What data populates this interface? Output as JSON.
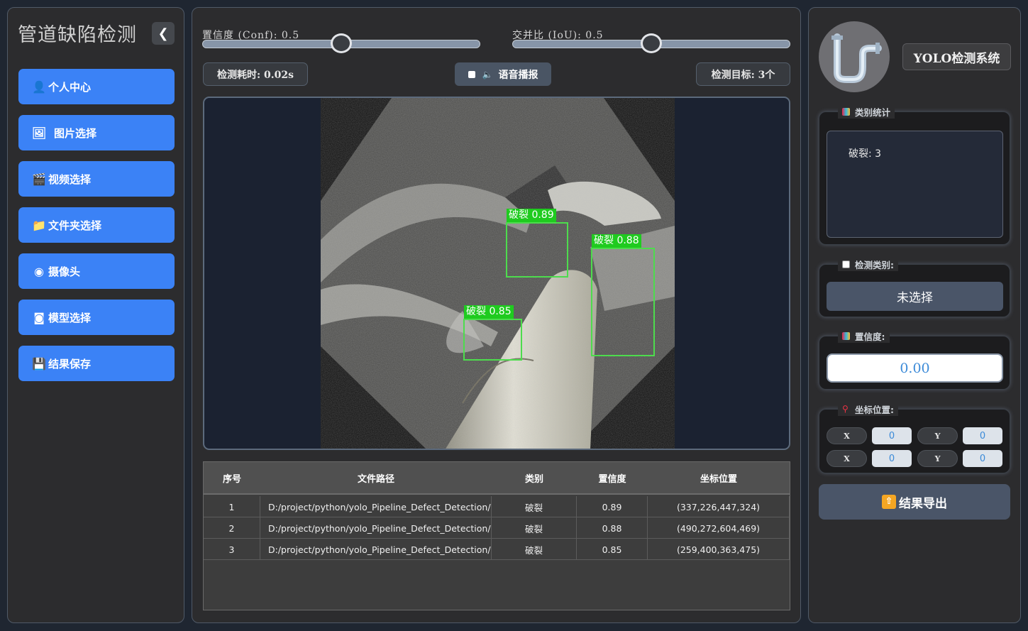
{
  "sidebar": {
    "title": "管道缺陷检测",
    "collapse_icon": "chevron-left-icon",
    "items": [
      {
        "label": "个人中心",
        "icon": "user-icon",
        "glyph": "👤"
      },
      {
        "label": "图片选择",
        "icon": "image-icon",
        "glyph": "🖼"
      },
      {
        "label": "视频选择",
        "icon": "clapper-icon",
        "glyph": "🎬"
      },
      {
        "label": "文件夹选择",
        "icon": "folder-icon",
        "glyph": "📁"
      },
      {
        "label": "摄像头",
        "icon": "webcam-icon",
        "glyph": "◉"
      },
      {
        "label": "模型选择",
        "icon": "model-icon",
        "glyph": "◙"
      },
      {
        "label": "结果保存",
        "icon": "save-icon",
        "glyph": "💾"
      }
    ],
    "accent": "#3b82f6"
  },
  "controls": {
    "conf_label": "置信度 (Conf): 0.5",
    "conf_value": 0.5,
    "iou_label": "交并比 (IoU): 0.5",
    "iou_value": 0.5,
    "time_chip": "检测耗时: 0.02s",
    "voice_label": "语音播报",
    "target_chip": "检测目标: 3个"
  },
  "detections": [
    {
      "label": "破裂 0.89"
    },
    {
      "label": "破裂 0.88"
    },
    {
      "label": "破裂 0.85"
    }
  ],
  "table": {
    "headers": [
      "序号",
      "文件路径",
      "类别",
      "置信度",
      "坐标位置"
    ],
    "rows": [
      [
        "1",
        "D:/project/python/yolo_Pipeline_Defect_Detection/...",
        "破裂",
        "0.89",
        "(337,226,447,324)"
      ],
      [
        "2",
        "D:/project/python/yolo_Pipeline_Defect_Detection/...",
        "破裂",
        "0.88",
        "(490,272,604,469)"
      ],
      [
        "3",
        "D:/project/python/yolo_Pipeline_Defect_Detection/...",
        "破裂",
        "0.85",
        "(259,400,363,475)"
      ]
    ]
  },
  "right": {
    "logo_icon": "pipe-icon",
    "system_title": "YOLO检测系统",
    "stats_title": "类别统计",
    "stats_text": "破裂: 3",
    "class_title": "检测类别:",
    "class_value": "未选择",
    "conf_title": "置信度:",
    "conf_value": "0.00",
    "coord_title": "坐标位置:",
    "coords": [
      {
        "label": "X",
        "value": "0"
      },
      {
        "label": "Y",
        "value": "0"
      },
      {
        "label": "X",
        "value": "0"
      },
      {
        "label": "Y",
        "value": "0"
      }
    ],
    "export_label": "结果导出"
  }
}
